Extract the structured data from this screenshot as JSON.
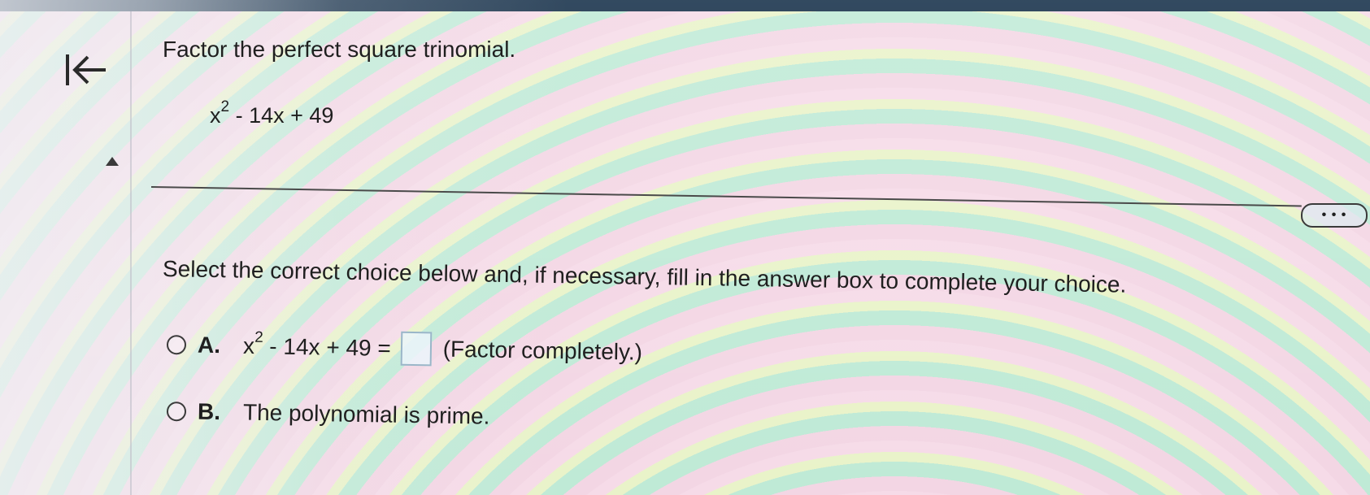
{
  "question": {
    "title": "Factor the perfect square trinomial.",
    "expression": {
      "base": "x",
      "exponent": "2",
      "rest": " - 14x + 49"
    }
  },
  "instructions": "Select the correct choice below and, if necessary, fill in the answer box to complete your choice.",
  "choices": [
    {
      "letter": "A.",
      "base": "x",
      "exponent": "2",
      "rest": " - 14x + 49 =",
      "answer_value": "",
      "suffix": "(Factor completely.)"
    },
    {
      "letter": "B.",
      "text": "The polynomial is prime."
    }
  ],
  "more_button_label": "• • •",
  "icons": {
    "back": "back-to-start-icon",
    "collapse": "collapse-triangle-icon",
    "radio": "radio-button-icon"
  },
  "colors": {
    "topbar": "#0f2a44",
    "text": "#1f1f1f"
  }
}
